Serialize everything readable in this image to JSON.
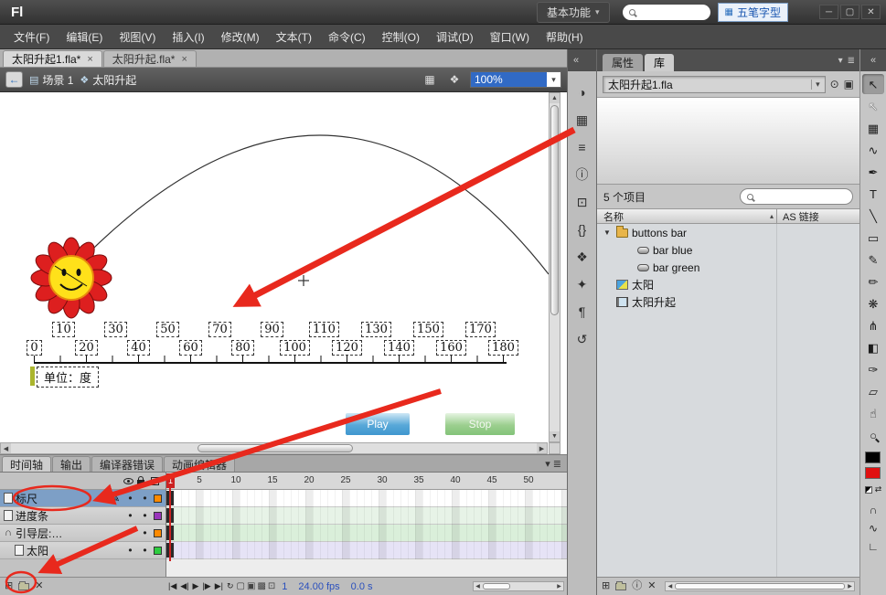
{
  "colors": {
    "annotation": "#e8291d",
    "layer_selection": "#7d9fc6",
    "fill_chip": "#e01010",
    "stroke_chip": "#000000"
  },
  "titlebar": {
    "logo": "Fl",
    "workspace_button": "基本功能",
    "ime_label": "五笔字型",
    "minimize": "─",
    "maximize": "▢",
    "close": "✕"
  },
  "menubar": {
    "items": [
      "文件(F)",
      "编辑(E)",
      "视图(V)",
      "插入(I)",
      "修改(M)",
      "文本(T)",
      "命令(C)",
      "控制(O)",
      "调试(D)",
      "窗口(W)",
      "帮助(H)"
    ]
  },
  "doc_tabs": [
    {
      "label": "太阳升起1.fla*",
      "close": "×",
      "active": true
    },
    {
      "label": "太阳升起.fla*",
      "close": "×",
      "active": false
    }
  ],
  "edit_bar": {
    "scene": "场景 1",
    "symbol": "太阳升起",
    "zoom": "100%"
  },
  "stage": {
    "ruler_top": [
      "10",
      "30",
      "50",
      "70",
      "90",
      "110",
      "130",
      "150",
      "170"
    ],
    "ruler_bottom": [
      "0",
      "20",
      "40",
      "60",
      "80",
      "100",
      "120",
      "140",
      "160",
      "180"
    ],
    "unit_label": "单位：度",
    "play_label": "Play",
    "stop_label": "Stop"
  },
  "panel_strip": {
    "collapse": "«",
    "icons": [
      {
        "name": "color-panel-icon",
        "glyph": "◑"
      },
      {
        "name": "swatches-panel-icon",
        "glyph": "▦"
      },
      {
        "name": "align-panel-icon",
        "glyph": "≡"
      },
      {
        "name": "info-panel-icon",
        "glyph": "ⓘ"
      },
      {
        "name": "transform-panel-icon",
        "glyph": "⊡"
      },
      {
        "name": "code-snippets-panel-icon",
        "glyph": "{}"
      },
      {
        "name": "components-panel-icon",
        "glyph": "❖"
      },
      {
        "name": "motion-presets-panel-icon",
        "glyph": "✦"
      },
      {
        "name": "strings-panel-icon",
        "glyph": "¶"
      },
      {
        "name": "history-panel-icon",
        "glyph": "↺"
      }
    ]
  },
  "library": {
    "tabs": [
      {
        "label": "属性",
        "active": false
      },
      {
        "label": "库",
        "active": true
      }
    ],
    "document_name": "太阳升起1.fla",
    "item_count": "5 个项目",
    "name_column": "名称",
    "linkage_column": "AS 链接",
    "items": [
      {
        "label": "buttons bar",
        "icon": "folder",
        "indent": 0,
        "disclosure": "▼"
      },
      {
        "label": "bar blue",
        "icon": "button",
        "indent": 1,
        "disclosure": ""
      },
      {
        "label": "bar green",
        "icon": "button",
        "indent": 1,
        "disclosure": ""
      },
      {
        "label": "太阳",
        "icon": "graphic",
        "indent": 0,
        "disclosure": ""
      },
      {
        "label": "太阳升起",
        "icon": "clip",
        "indent": 0,
        "disclosure": ""
      }
    ]
  },
  "tools": [
    {
      "name": "selection-tool",
      "glyph": "↖",
      "active": true
    },
    {
      "name": "subselection-tool",
      "glyph": "↖",
      "hollow": true
    },
    {
      "name": "free-transform-tool",
      "glyph": "▦"
    },
    {
      "name": "lasso-tool",
      "glyph": "∿"
    },
    {
      "name": "pen-tool",
      "glyph": "✒"
    },
    {
      "name": "text-tool",
      "glyph": "T"
    },
    {
      "name": "line-tool",
      "glyph": "╲"
    },
    {
      "name": "rectangle-tool",
      "glyph": "▭"
    },
    {
      "name": "pencil-tool",
      "glyph": "✎"
    },
    {
      "name": "brush-tool",
      "glyph": "✏"
    },
    {
      "name": "deco-tool",
      "glyph": "❋"
    },
    {
      "name": "bone-tool",
      "glyph": "⋔"
    },
    {
      "name": "paint-bucket-tool",
      "glyph": "◧"
    },
    {
      "name": "eyedropper-tool",
      "glyph": "✑"
    },
    {
      "name": "eraser-tool",
      "glyph": "▱"
    },
    {
      "name": "hand-tool",
      "glyph": "☝"
    },
    {
      "name": "zoom-tool",
      "glyph": "○"
    }
  ],
  "timeline": {
    "tabs": [
      {
        "label": "时间轴",
        "active": true
      },
      {
        "label": "输出",
        "active": false
      },
      {
        "label": "编译器错误",
        "active": false
      },
      {
        "label": "动画编辑器",
        "active": false
      }
    ],
    "ruler_numbers": [
      "5",
      "10",
      "15",
      "20",
      "25",
      "30",
      "35",
      "40",
      "45",
      "50"
    ],
    "current_frame": "1",
    "layers": [
      {
        "name": "标尺",
        "color": "#ff8a00",
        "selected": true,
        "band": ""
      },
      {
        "name": "进度条",
        "color": "#9933bb",
        "band": "#e7f3e7"
      },
      {
        "name": "引导层:…",
        "color": "#ff8a00",
        "guide": true,
        "band": "#daefda"
      },
      {
        "name": "太阳",
        "color": "#2ecc40",
        "indent": 1,
        "band": "#e6e3f6"
      }
    ],
    "fps": "24.00 fps",
    "time": "0.0 s"
  }
}
